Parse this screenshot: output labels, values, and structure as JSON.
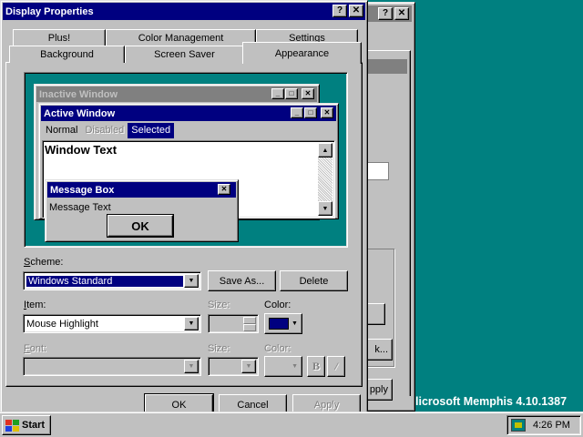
{
  "desktop": {
    "build_text": "Microsoft Memphis 4.10.1387",
    "build_visible_text": "licrosoft Memphis 4.10.1387"
  },
  "background_window": {
    "help_glyph": "?",
    "close_glyph": "✕",
    "partial_button_1": "k...",
    "partial_button_2": "pply"
  },
  "dialog": {
    "title": "Display Properties",
    "help_glyph": "?",
    "close_glyph": "✕",
    "tabs_back": [
      "Plus!",
      "Color Management",
      "Settings"
    ],
    "tabs_front": [
      "Background",
      "Screen Saver",
      "Appearance"
    ],
    "active_tab": "Appearance",
    "preview": {
      "inactive_title": "Inactive Window",
      "active_title": "Active Window",
      "menu_normal": "Normal",
      "menu_disabled": "Disabled",
      "menu_selected": "Selected",
      "window_text": "Window Text",
      "msgbox_title": "Message Box",
      "msgbox_text": "Message Text",
      "msgbox_ok": "OK"
    },
    "scheme": {
      "label": "Scheme:",
      "value": "Windows Standard",
      "save_as": "Save As...",
      "delete": "Delete"
    },
    "item": {
      "label": "Item:",
      "value": "Mouse Highlight",
      "size_label": "Size:",
      "color_label": "Color:",
      "color_value": "#000080"
    },
    "font": {
      "label": "Font:",
      "value": "",
      "size_label": "Size:",
      "color_label": "Color:",
      "bold": "B",
      "italic": "/"
    },
    "buttons": {
      "ok": "OK",
      "cancel": "Cancel",
      "apply": "Apply"
    }
  },
  "taskbar": {
    "start": "Start",
    "time": "4:26 PM"
  },
  "colors": {
    "desktop": "#008080",
    "face": "#c0c0c0",
    "active_title": "#000080",
    "inactive_title": "#808080",
    "highlight": "#000080"
  }
}
